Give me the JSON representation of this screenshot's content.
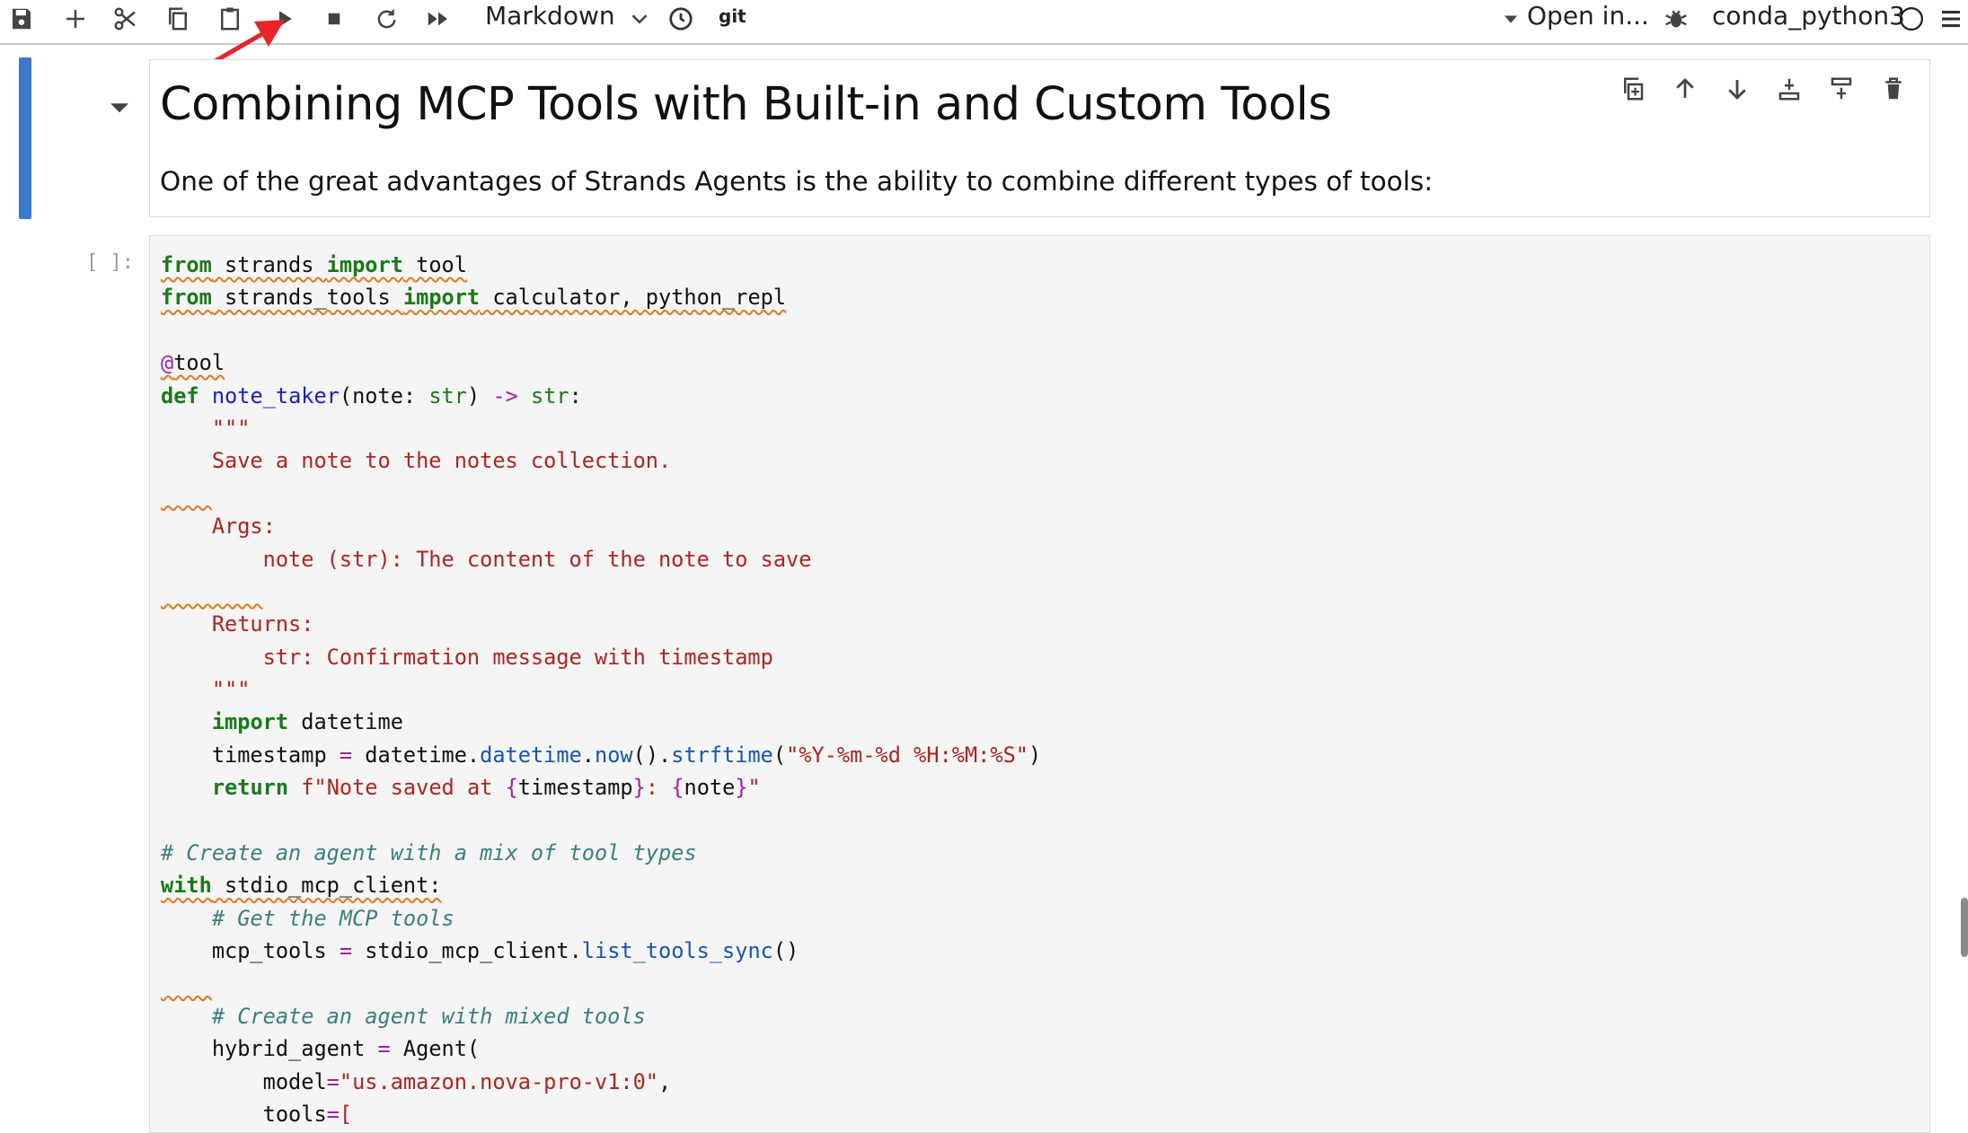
{
  "toolbar": {
    "cell_type": "Markdown",
    "git_label": "git",
    "open_in": "Open in...",
    "kernel_name": "conda_python3"
  },
  "markdown_cell": {
    "title": "Combining MCP Tools with Built-in and Custom Tools",
    "paragraph": "One of the great advantages of Strands Agents is the ability to combine different types of tools:"
  },
  "code_cell": {
    "prompt": "[ ]:",
    "lines": [
      "from strands import tool",
      "from strands_tools import calculator, python_repl",
      "",
      "@tool",
      "def note_taker(note: str) -> str:",
      "    \"\"\"",
      "    Save a note to the notes collection.",
      "    ",
      "    Args:",
      "        note (str): The content of the note to save",
      "        ",
      "    Returns:",
      "        str: Confirmation message with timestamp",
      "    \"\"\"",
      "    import datetime",
      "    timestamp = datetime.datetime.now().strftime(\"%Y-%m-%d %H:%M:%S\")",
      "    return f\"Note saved at {timestamp}: {note}\"",
      "",
      "# Create an agent with a mix of tool types",
      "with stdio_mcp_client:",
      "    # Get the MCP tools",
      "    mcp_tools = stdio_mcp_client.list_tools_sync()",
      "    ",
      "    # Create an agent with mixed tools",
      "    hybrid_agent = Agent(",
      "        model=\"us.amazon.nova-pro-v1:0\",",
      "        tools=["
    ]
  },
  "colors": {
    "active_cell_bar": "#3b78d0",
    "annotation_arrow": "#e8242a",
    "keyword": "#1a7a1a",
    "string": "#b2231f",
    "comment": "#3b7f82"
  }
}
